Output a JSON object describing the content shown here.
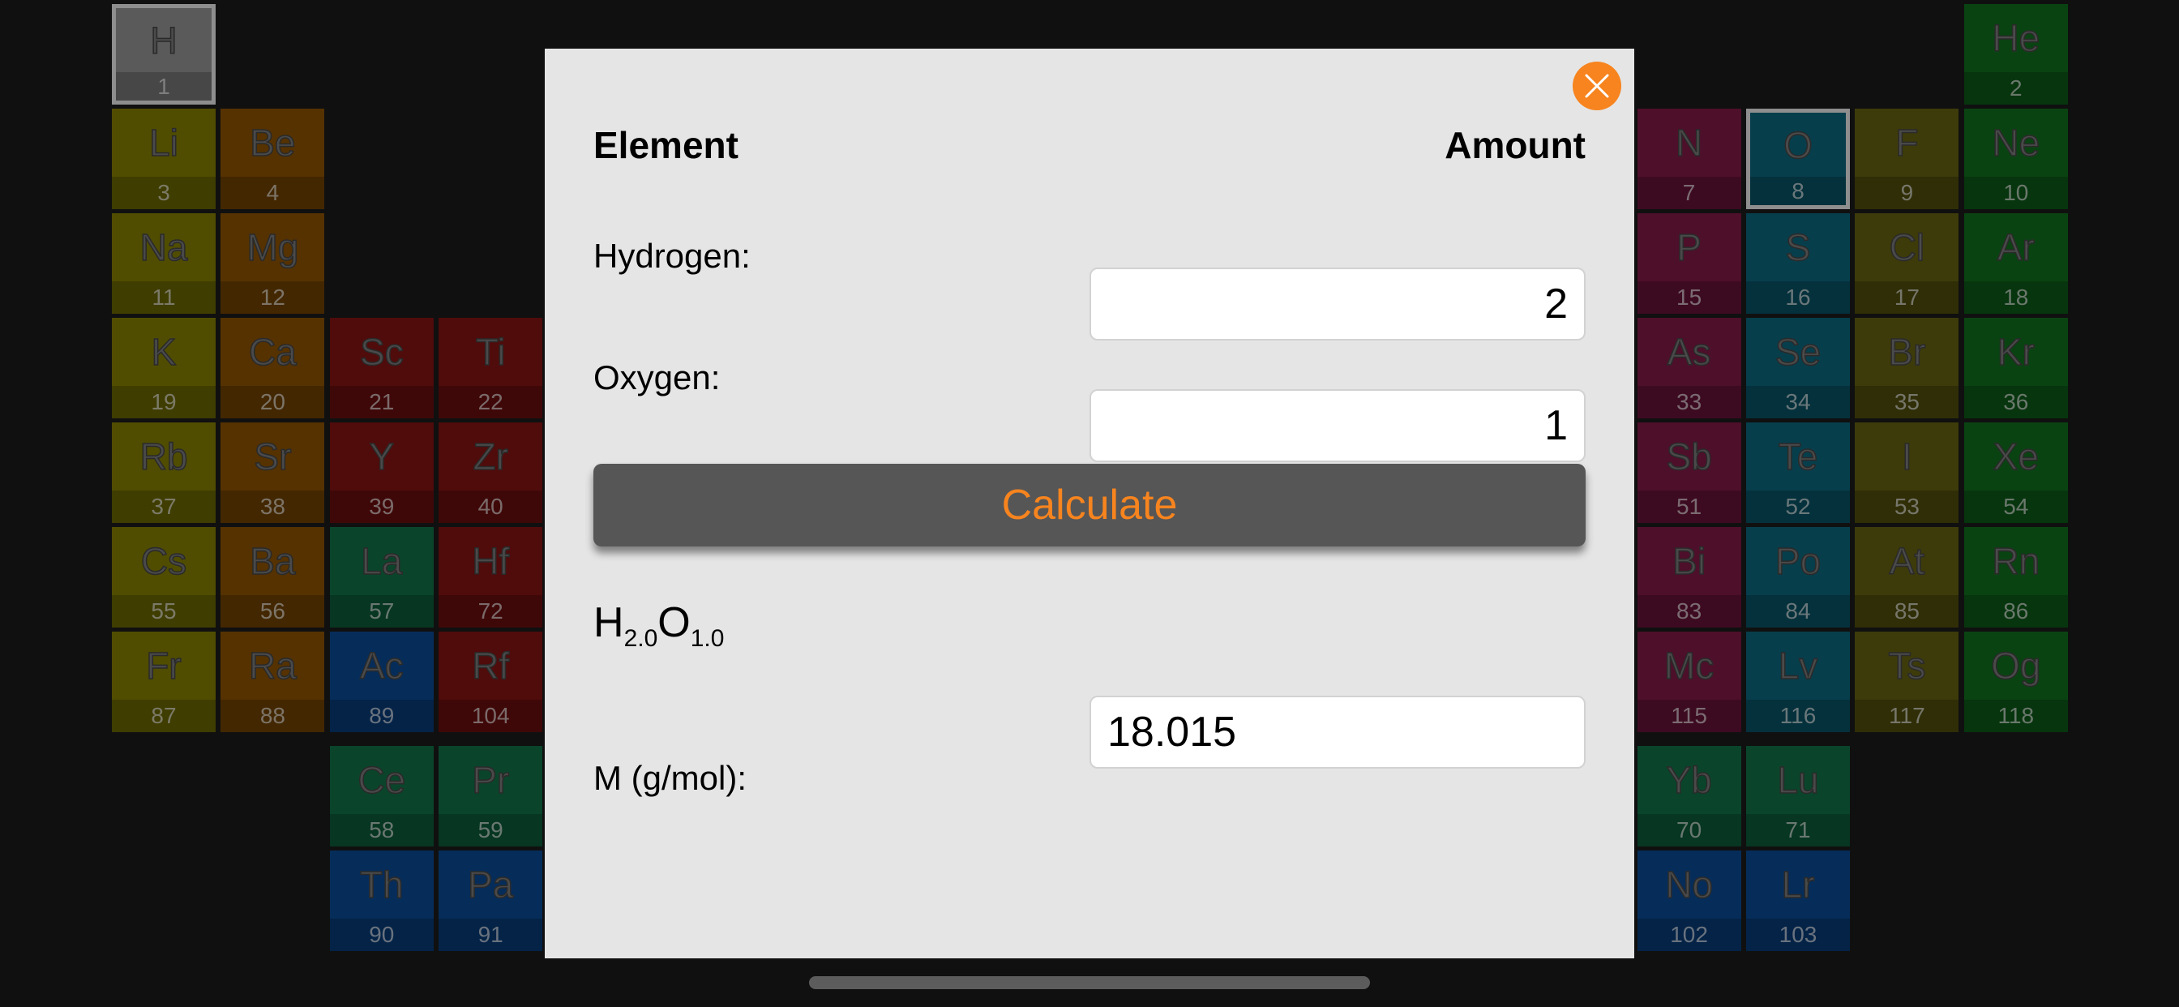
{
  "colors": {
    "alkali": "#504d00",
    "alkaline_earth": "#553200",
    "transition": "#500b0b",
    "lanthanide": "#0a452b",
    "actinide": "#062d5a",
    "hydrogen": "#5a5a5a",
    "post_transition": "#4e0f2a",
    "metalloid": "#073e4c",
    "halogen": "#3d3b0a",
    "noble_gas": "#0a4312",
    "accent": "#f7841e",
    "modal_bg": "#e5e5e5"
  },
  "periodic_table": [
    {
      "symbol": "H",
      "number": "1",
      "cat": "hydrogen",
      "col": 0,
      "row": 0,
      "selected": true
    },
    {
      "symbol": "He",
      "number": "2",
      "cat": "noble_gas",
      "col": 17,
      "row": 0
    },
    {
      "symbol": "Li",
      "number": "3",
      "cat": "alkali",
      "col": 0,
      "row": 1
    },
    {
      "symbol": "Be",
      "number": "4",
      "cat": "alkaline_earth",
      "col": 1,
      "row": 1
    },
    {
      "symbol": "N",
      "number": "7",
      "cat": "post_transition",
      "col": 14,
      "row": 1
    },
    {
      "symbol": "O",
      "number": "8",
      "cat": "metalloid",
      "col": 15,
      "row": 1,
      "selected": true
    },
    {
      "symbol": "F",
      "number": "9",
      "cat": "halogen",
      "col": 16,
      "row": 1
    },
    {
      "symbol": "Ne",
      "number": "10",
      "cat": "noble_gas",
      "col": 17,
      "row": 1
    },
    {
      "symbol": "Na",
      "number": "11",
      "cat": "alkali",
      "col": 0,
      "row": 2
    },
    {
      "symbol": "Mg",
      "number": "12",
      "cat": "alkaline_earth",
      "col": 1,
      "row": 2
    },
    {
      "symbol": "P",
      "number": "15",
      "cat": "post_transition",
      "col": 14,
      "row": 2
    },
    {
      "symbol": "S",
      "number": "16",
      "cat": "metalloid",
      "col": 15,
      "row": 2
    },
    {
      "symbol": "Cl",
      "number": "17",
      "cat": "halogen",
      "col": 16,
      "row": 2
    },
    {
      "symbol": "Ar",
      "number": "18",
      "cat": "noble_gas",
      "col": 17,
      "row": 2
    },
    {
      "symbol": "K",
      "number": "19",
      "cat": "alkali",
      "col": 0,
      "row": 3
    },
    {
      "symbol": "Ca",
      "number": "20",
      "cat": "alkaline_earth",
      "col": 1,
      "row": 3
    },
    {
      "symbol": "Sc",
      "number": "21",
      "cat": "transition",
      "col": 2,
      "row": 3
    },
    {
      "symbol": "Ti",
      "number": "22",
      "cat": "transition",
      "col": 3,
      "row": 3
    },
    {
      "symbol": "As",
      "number": "33",
      "cat": "post_transition",
      "col": 14,
      "row": 3
    },
    {
      "symbol": "Se",
      "number": "34",
      "cat": "metalloid",
      "col": 15,
      "row": 3
    },
    {
      "symbol": "Br",
      "number": "35",
      "cat": "halogen",
      "col": 16,
      "row": 3
    },
    {
      "symbol": "Kr",
      "number": "36",
      "cat": "noble_gas",
      "col": 17,
      "row": 3
    },
    {
      "symbol": "Rb",
      "number": "37",
      "cat": "alkali",
      "col": 0,
      "row": 4
    },
    {
      "symbol": "Sr",
      "number": "38",
      "cat": "alkaline_earth",
      "col": 1,
      "row": 4
    },
    {
      "symbol": "Y",
      "number": "39",
      "cat": "transition",
      "col": 2,
      "row": 4
    },
    {
      "symbol": "Zr",
      "number": "40",
      "cat": "transition",
      "col": 3,
      "row": 4
    },
    {
      "symbol": "Sb",
      "number": "51",
      "cat": "post_transition",
      "col": 14,
      "row": 4
    },
    {
      "symbol": "Te",
      "number": "52",
      "cat": "metalloid",
      "col": 15,
      "row": 4
    },
    {
      "symbol": "I",
      "number": "53",
      "cat": "halogen",
      "col": 16,
      "row": 4
    },
    {
      "symbol": "Xe",
      "number": "54",
      "cat": "noble_gas",
      "col": 17,
      "row": 4
    },
    {
      "symbol": "Cs",
      "number": "55",
      "cat": "alkali",
      "col": 0,
      "row": 5
    },
    {
      "symbol": "Ba",
      "number": "56",
      "cat": "alkaline_earth",
      "col": 1,
      "row": 5
    },
    {
      "symbol": "La",
      "number": "57",
      "cat": "lanthanide",
      "col": 2,
      "row": 5
    },
    {
      "symbol": "Hf",
      "number": "72",
      "cat": "transition",
      "col": 3,
      "row": 5
    },
    {
      "symbol": "Bi",
      "number": "83",
      "cat": "post_transition",
      "col": 14,
      "row": 5
    },
    {
      "symbol": "Po",
      "number": "84",
      "cat": "metalloid",
      "col": 15,
      "row": 5
    },
    {
      "symbol": "At",
      "number": "85",
      "cat": "halogen",
      "col": 16,
      "row": 5
    },
    {
      "symbol": "Rn",
      "number": "86",
      "cat": "noble_gas",
      "col": 17,
      "row": 5
    },
    {
      "symbol": "Fr",
      "number": "87",
      "cat": "alkali",
      "col": 0,
      "row": 6
    },
    {
      "symbol": "Ra",
      "number": "88",
      "cat": "alkaline_earth",
      "col": 1,
      "row": 6
    },
    {
      "symbol": "Ac",
      "number": "89",
      "cat": "actinide",
      "col": 2,
      "row": 6
    },
    {
      "symbol": "Rf",
      "number": "104",
      "cat": "transition",
      "col": 3,
      "row": 6
    },
    {
      "symbol": "Mc",
      "number": "115",
      "cat": "post_transition",
      "col": 14,
      "row": 6
    },
    {
      "symbol": "Lv",
      "number": "116",
      "cat": "metalloid",
      "col": 15,
      "row": 6
    },
    {
      "symbol": "Ts",
      "number": "117",
      "cat": "halogen",
      "col": 16,
      "row": 6
    },
    {
      "symbol": "Og",
      "number": "118",
      "cat": "noble_gas",
      "col": 17,
      "row": 6
    },
    {
      "symbol": "Ce",
      "number": "58",
      "cat": "lanthanide",
      "col": 2,
      "row": 7
    },
    {
      "symbol": "Pr",
      "number": "59",
      "cat": "lanthanide",
      "col": 3,
      "row": 7
    },
    {
      "symbol": "Yb",
      "number": "70",
      "cat": "lanthanide",
      "col": 14,
      "row": 7
    },
    {
      "symbol": "Lu",
      "number": "71",
      "cat": "lanthanide",
      "col": 15,
      "row": 7
    },
    {
      "symbol": "Th",
      "number": "90",
      "cat": "actinide",
      "col": 2,
      "row": 8
    },
    {
      "symbol": "Pa",
      "number": "91",
      "cat": "actinide",
      "col": 3,
      "row": 8
    },
    {
      "symbol": "No",
      "number": "102",
      "cat": "actinide",
      "col": 14,
      "row": 8
    },
    {
      "symbol": "Lr",
      "number": "103",
      "cat": "actinide",
      "col": 15,
      "row": 8
    }
  ],
  "modal": {
    "close_icon": "close-icon",
    "header_element": "Element",
    "header_amount": "Amount",
    "rows": [
      {
        "label": "Hydrogen:",
        "value": "2"
      },
      {
        "label": "Oxygen:",
        "value": "1"
      }
    ],
    "calculate_label": "Calculate",
    "formula": [
      {
        "symbol": "H",
        "count": "2.0"
      },
      {
        "symbol": "O",
        "count": "1.0"
      }
    ],
    "molar_mass_label": "M (g/mol):",
    "molar_mass_value": "18.015"
  }
}
